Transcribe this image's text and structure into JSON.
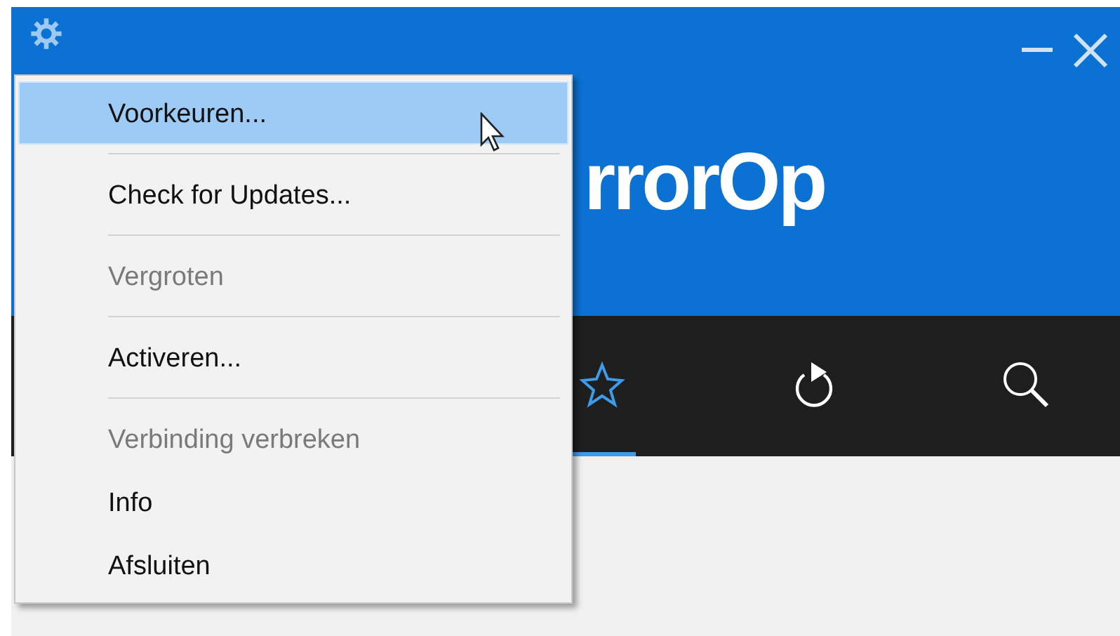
{
  "header": {
    "title": "rrorOp"
  },
  "nav": {
    "tabs": [
      {
        "kind": "star",
        "selected": true
      },
      {
        "kind": "refresh",
        "selected": false
      },
      {
        "kind": "search",
        "selected": false
      }
    ]
  },
  "menu": {
    "items": [
      {
        "kind": "item",
        "label": "Voorkeuren...",
        "selected": true,
        "disabled": false
      },
      {
        "kind": "separator"
      },
      {
        "kind": "item",
        "label": "Check for Updates...",
        "selected": false,
        "disabled": false
      },
      {
        "kind": "separator"
      },
      {
        "kind": "item",
        "label": "Vergroten",
        "selected": false,
        "disabled": true
      },
      {
        "kind": "separator"
      },
      {
        "kind": "item",
        "label": "Activeren...",
        "selected": false,
        "disabled": false
      },
      {
        "kind": "separator"
      },
      {
        "kind": "item",
        "label": "Verbinding verbreken",
        "selected": false,
        "disabled": true
      },
      {
        "kind": "item",
        "label": "Info",
        "selected": false,
        "disabled": false
      },
      {
        "kind": "item",
        "label": "Afsluiten",
        "selected": false,
        "disabled": false
      }
    ]
  }
}
